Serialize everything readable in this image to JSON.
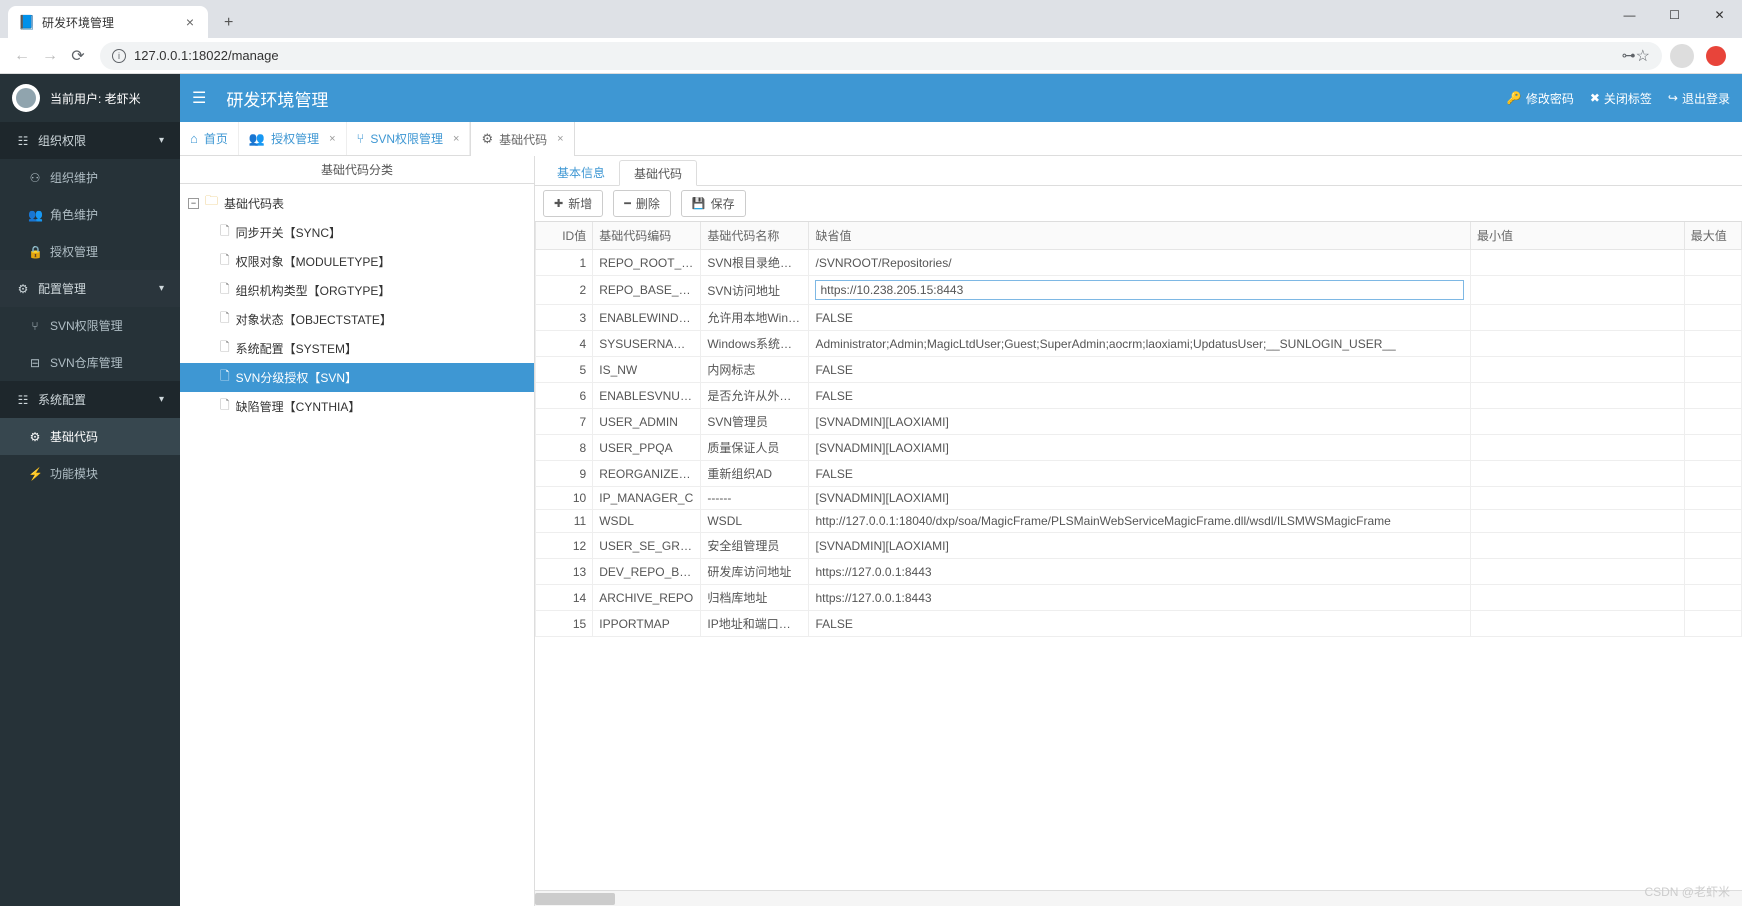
{
  "browser": {
    "tab_title": "研发环境管理",
    "url": "127.0.0.1:18022/manage"
  },
  "user": {
    "label": "当前用户: 老虾米"
  },
  "sidebar": {
    "groups": [
      {
        "label": "组织权限",
        "expanded": true,
        "items": [
          {
            "label": "组织维护"
          },
          {
            "label": "角色维护"
          },
          {
            "label": "授权管理"
          }
        ]
      },
      {
        "label": "配置管理",
        "expanded": true,
        "items": [
          {
            "label": "SVN权限管理"
          },
          {
            "label": "SVN仓库管理"
          }
        ]
      },
      {
        "label": "系统配置",
        "expanded": true,
        "items": [
          {
            "label": "基础代码",
            "active": true
          },
          {
            "label": "功能模块"
          }
        ]
      }
    ]
  },
  "header": {
    "title": "研发环境管理",
    "actions": [
      {
        "label": "修改密码"
      },
      {
        "label": "关闭标签"
      },
      {
        "label": "退出登录"
      }
    ]
  },
  "app_tabs": [
    {
      "label": "首页",
      "icon": "home"
    },
    {
      "label": "授权管理",
      "icon": "auth",
      "closable": true
    },
    {
      "label": "SVN权限管理",
      "icon": "branch",
      "closable": true
    },
    {
      "label": "基础代码",
      "icon": "gear",
      "closable": true,
      "active": true
    }
  ],
  "tree": {
    "header": "基础代码分类",
    "root": "基础代码表",
    "items": [
      {
        "label": "同步开关【SYNC】"
      },
      {
        "label": "权限对象【MODULETYPE】"
      },
      {
        "label": "组织机构类型【ORGTYPE】"
      },
      {
        "label": "对象状态【OBJECTSTATE】"
      },
      {
        "label": "系统配置【SYSTEM】"
      },
      {
        "label": "SVN分级授权【SVN】",
        "selected": true
      },
      {
        "label": "缺陷管理【CYNTHIA】"
      }
    ]
  },
  "sub_tabs": [
    {
      "label": "基本信息"
    },
    {
      "label": "基础代码",
      "active": true
    }
  ],
  "toolbar": [
    {
      "label": "新增",
      "icon": "plus"
    },
    {
      "label": "删除",
      "icon": "minus"
    },
    {
      "label": "保存",
      "icon": "save"
    }
  ],
  "grid": {
    "columns": [
      "ID值",
      "基础代码编码",
      "基础代码名称",
      "缺省值",
      "最小值",
      "最大值"
    ],
    "rows": [
      {
        "id": "1",
        "code": "REPO_ROOT_DIR",
        "name": "SVN根目录绝对路径",
        "def": "/SVNROOT/Repositories/"
      },
      {
        "id": "2",
        "code": "REPO_BASE_URL",
        "name": "SVN访问地址",
        "def": "https://10.238.205.15:8443",
        "editing": true
      },
      {
        "id": "3",
        "code": "ENABLEWINDOWS",
        "name": "允许用本地Windows",
        "def": "FALSE"
      },
      {
        "id": "4",
        "code": "SYSUSERNAMES",
        "name": "Windows系统账号",
        "def": "Administrator;Admin;MagicLtdUser;Guest;SuperAdmin;aocrm;laoxiami;UpdatusUser;__SUNLOGIN_USER__"
      },
      {
        "id": "5",
        "code": "IS_NW",
        "name": "内网标志",
        "def": "FALSE"
      },
      {
        "id": "6",
        "code": "ENABLESVNUSER",
        "name": "是否允许从外部数据",
        "def": "FALSE"
      },
      {
        "id": "7",
        "code": "USER_ADMIN",
        "name": "SVN管理员",
        "def": "[SVNADMIN][LAOXIAMI]"
      },
      {
        "id": "8",
        "code": "USER_PPQA",
        "name": "质量保证人员",
        "def": "[SVNADMIN][LAOXIAMI]"
      },
      {
        "id": "9",
        "code": "REORGANIZEORG",
        "name": "重新组织AD",
        "def": "FALSE"
      },
      {
        "id": "10",
        "code": "IP_MANAGER_C",
        "name": "------",
        "def": "[SVNADMIN][LAOXIAMI]"
      },
      {
        "id": "11",
        "code": "WSDL",
        "name": "WSDL",
        "def": "http://127.0.0.1:18040/dxp/soa/MagicFrame/PLSMainWebServiceMagicFrame.dll/wsdl/ILSMWSMagicFrame"
      },
      {
        "id": "12",
        "code": "USER_SE_GROUP",
        "name": "安全组管理员",
        "def": "[SVNADMIN][LAOXIAMI]"
      },
      {
        "id": "13",
        "code": "DEV_REPO_BASE",
        "name": "研发库访问地址",
        "def": "https://127.0.0.1:8443"
      },
      {
        "id": "14",
        "code": "ARCHIVE_REPO",
        "name": "归档库地址",
        "def": "https://127.0.0.1:8443"
      },
      {
        "id": "15",
        "code": "IPPORTMAP",
        "name": "IP地址和端口映射",
        "def": "FALSE"
      }
    ]
  },
  "watermark": "CSDN @老虾米"
}
